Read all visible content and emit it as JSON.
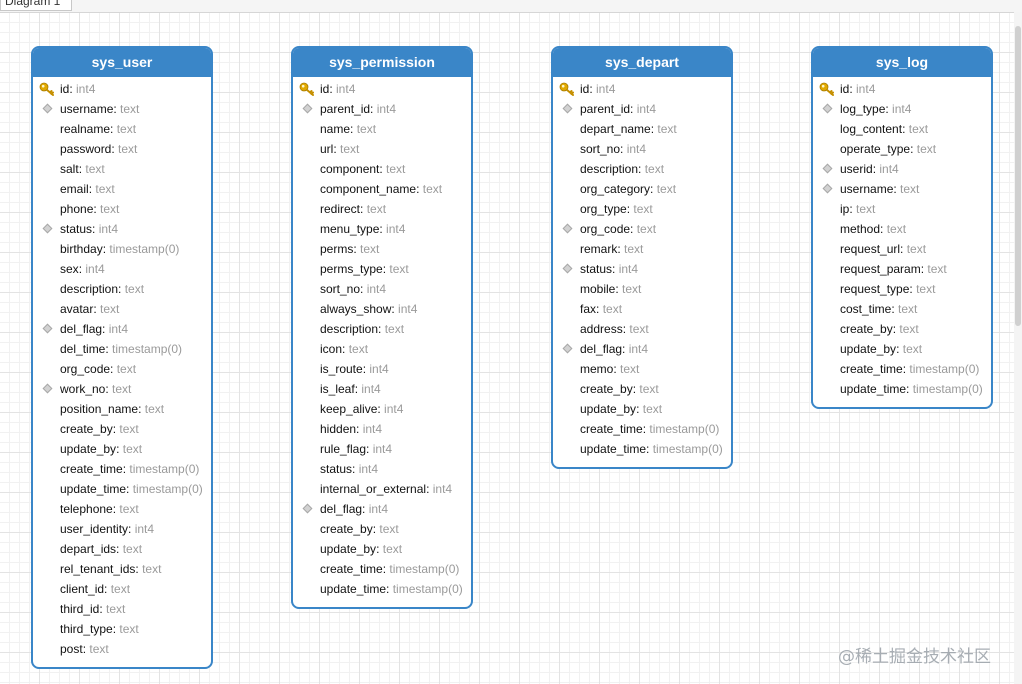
{
  "tab": {
    "label": "Diagram 1"
  },
  "watermark": "@稀土掘金技术社区",
  "colors": {
    "header": "#3a86c8",
    "type_text": "#9a9a9a",
    "pk_icon": "#e0a800"
  },
  "tables": [
    {
      "name": "sys_user",
      "columns": [
        {
          "name": "id",
          "type": "int4",
          "icon": "key-icon"
        },
        {
          "name": "username",
          "type": "text",
          "icon": "diamond-icon"
        },
        {
          "name": "realname",
          "type": "text",
          "icon": ""
        },
        {
          "name": "password",
          "type": "text",
          "icon": ""
        },
        {
          "name": "salt",
          "type": "text",
          "icon": ""
        },
        {
          "name": "email",
          "type": "text",
          "icon": ""
        },
        {
          "name": "phone",
          "type": "text",
          "icon": ""
        },
        {
          "name": "status",
          "type": "int4",
          "icon": "diamond-icon"
        },
        {
          "name": "birthday",
          "type": "timestamp(0)",
          "icon": ""
        },
        {
          "name": "sex",
          "type": "int4",
          "icon": ""
        },
        {
          "name": "description",
          "type": "text",
          "icon": ""
        },
        {
          "name": "avatar",
          "type": "text",
          "icon": ""
        },
        {
          "name": "del_flag",
          "type": "int4",
          "icon": "diamond-icon"
        },
        {
          "name": "del_time",
          "type": "timestamp(0)",
          "icon": ""
        },
        {
          "name": "org_code",
          "type": "text",
          "icon": ""
        },
        {
          "name": "work_no",
          "type": "text",
          "icon": "diamond-icon"
        },
        {
          "name": "position_name",
          "type": "text",
          "icon": ""
        },
        {
          "name": "create_by",
          "type": "text",
          "icon": ""
        },
        {
          "name": "update_by",
          "type": "text",
          "icon": ""
        },
        {
          "name": "create_time",
          "type": "timestamp(0)",
          "icon": ""
        },
        {
          "name": "update_time",
          "type": "timestamp(0)",
          "icon": ""
        },
        {
          "name": "telephone",
          "type": "text",
          "icon": ""
        },
        {
          "name": "user_identity",
          "type": "int4",
          "icon": ""
        },
        {
          "name": "depart_ids",
          "type": "text",
          "icon": ""
        },
        {
          "name": "rel_tenant_ids",
          "type": "text",
          "icon": ""
        },
        {
          "name": "client_id",
          "type": "text",
          "icon": ""
        },
        {
          "name": "third_id",
          "type": "text",
          "icon": ""
        },
        {
          "name": "third_type",
          "type": "text",
          "icon": ""
        },
        {
          "name": "post",
          "type": "text",
          "icon": ""
        }
      ]
    },
    {
      "name": "sys_permission",
      "columns": [
        {
          "name": "id",
          "type": "int4",
          "icon": "key-icon"
        },
        {
          "name": "parent_id",
          "type": "int4",
          "icon": "diamond-icon"
        },
        {
          "name": "name",
          "type": "text",
          "icon": ""
        },
        {
          "name": "url",
          "type": "text",
          "icon": ""
        },
        {
          "name": "component",
          "type": "text",
          "icon": ""
        },
        {
          "name": "component_name",
          "type": "text",
          "icon": ""
        },
        {
          "name": "redirect",
          "type": "text",
          "icon": ""
        },
        {
          "name": "menu_type",
          "type": "int4",
          "icon": ""
        },
        {
          "name": "perms",
          "type": "text",
          "icon": ""
        },
        {
          "name": "perms_type",
          "type": "text",
          "icon": ""
        },
        {
          "name": "sort_no",
          "type": "int4",
          "icon": ""
        },
        {
          "name": "always_show",
          "type": "int4",
          "icon": ""
        },
        {
          "name": "description",
          "type": "text",
          "icon": ""
        },
        {
          "name": "icon",
          "type": "text",
          "icon": ""
        },
        {
          "name": "is_route",
          "type": "int4",
          "icon": ""
        },
        {
          "name": "is_leaf",
          "type": "int4",
          "icon": ""
        },
        {
          "name": "keep_alive",
          "type": "int4",
          "icon": ""
        },
        {
          "name": "hidden",
          "type": "int4",
          "icon": ""
        },
        {
          "name": "rule_flag",
          "type": "int4",
          "icon": ""
        },
        {
          "name": "status",
          "type": "int4",
          "icon": ""
        },
        {
          "name": "internal_or_external",
          "type": "int4",
          "icon": ""
        },
        {
          "name": "del_flag",
          "type": "int4",
          "icon": "diamond-icon"
        },
        {
          "name": "create_by",
          "type": "text",
          "icon": ""
        },
        {
          "name": "update_by",
          "type": "text",
          "icon": ""
        },
        {
          "name": "create_time",
          "type": "timestamp(0)",
          "icon": ""
        },
        {
          "name": "update_time",
          "type": "timestamp(0)",
          "icon": ""
        }
      ]
    },
    {
      "name": "sys_depart",
      "columns": [
        {
          "name": "id",
          "type": "int4",
          "icon": "key-icon"
        },
        {
          "name": "parent_id",
          "type": "int4",
          "icon": "diamond-icon"
        },
        {
          "name": "depart_name",
          "type": "text",
          "icon": ""
        },
        {
          "name": "sort_no",
          "type": "int4",
          "icon": ""
        },
        {
          "name": "description",
          "type": "text",
          "icon": ""
        },
        {
          "name": "org_category",
          "type": "text",
          "icon": ""
        },
        {
          "name": "org_type",
          "type": "text",
          "icon": ""
        },
        {
          "name": "org_code",
          "type": "text",
          "icon": "diamond-icon"
        },
        {
          "name": "remark",
          "type": "text",
          "icon": ""
        },
        {
          "name": "status",
          "type": "int4",
          "icon": "diamond-icon"
        },
        {
          "name": "mobile",
          "type": "text",
          "icon": ""
        },
        {
          "name": "fax",
          "type": "text",
          "icon": ""
        },
        {
          "name": "address",
          "type": "text",
          "icon": ""
        },
        {
          "name": "del_flag",
          "type": "int4",
          "icon": "diamond-icon"
        },
        {
          "name": "memo",
          "type": "text",
          "icon": ""
        },
        {
          "name": "create_by",
          "type": "text",
          "icon": ""
        },
        {
          "name": "update_by",
          "type": "text",
          "icon": ""
        },
        {
          "name": "create_time",
          "type": "timestamp(0)",
          "icon": ""
        },
        {
          "name": "update_time",
          "type": "timestamp(0)",
          "icon": ""
        }
      ]
    },
    {
      "name": "sys_log",
      "columns": [
        {
          "name": "id",
          "type": "int4",
          "icon": "key-icon"
        },
        {
          "name": "log_type",
          "type": "int4",
          "icon": "diamond-icon"
        },
        {
          "name": "log_content",
          "type": "text",
          "icon": ""
        },
        {
          "name": "operate_type",
          "type": "text",
          "icon": ""
        },
        {
          "name": "userid",
          "type": "int4",
          "icon": "diamond-icon"
        },
        {
          "name": "username",
          "type": "text",
          "icon": "diamond-icon"
        },
        {
          "name": "ip",
          "type": "text",
          "icon": ""
        },
        {
          "name": "method",
          "type": "text",
          "icon": ""
        },
        {
          "name": "request_url",
          "type": "text",
          "icon": ""
        },
        {
          "name": "request_param",
          "type": "text",
          "icon": ""
        },
        {
          "name": "request_type",
          "type": "text",
          "icon": ""
        },
        {
          "name": "cost_time",
          "type": "text",
          "icon": ""
        },
        {
          "name": "create_by",
          "type": "text",
          "icon": ""
        },
        {
          "name": "update_by",
          "type": "text",
          "icon": ""
        },
        {
          "name": "create_time",
          "type": "timestamp(0)",
          "icon": ""
        },
        {
          "name": "update_time",
          "type": "timestamp(0)",
          "icon": ""
        }
      ]
    }
  ]
}
